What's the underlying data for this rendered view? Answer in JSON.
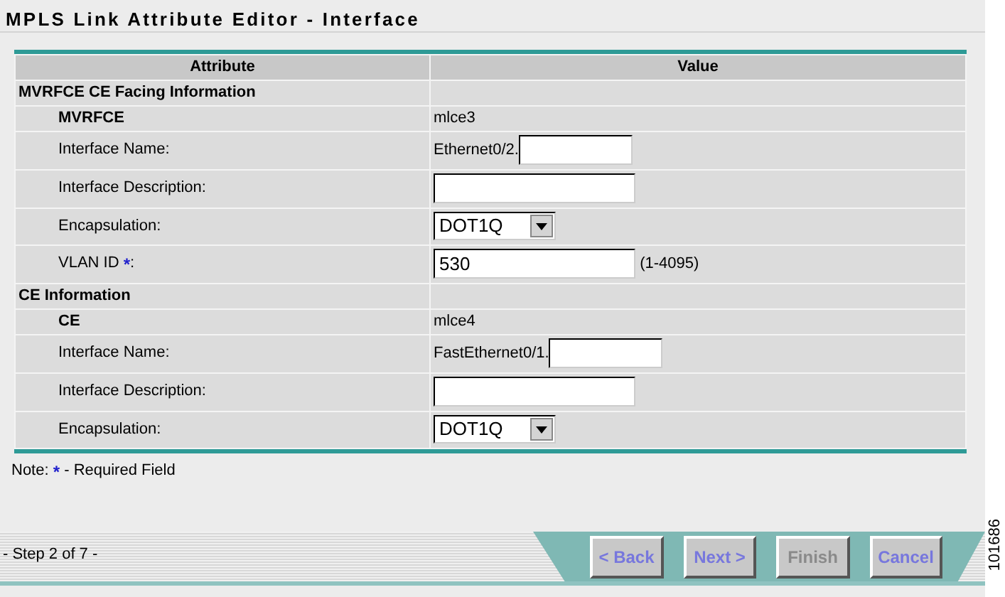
{
  "title": "MPLS Link Attribute Editor - Interface",
  "table": {
    "columns": [
      "Attribute",
      "Value"
    ],
    "sections": [
      {
        "heading": "MVRFCE CE Facing Information",
        "rows": [
          {
            "kind": "text",
            "label": "MVRFCE",
            "bold": true,
            "value": "mlce3"
          },
          {
            "kind": "prefix_input",
            "label": "Interface Name:",
            "prefix": "Ethernet0/2."
          },
          {
            "kind": "input",
            "label": "Interface Description:"
          },
          {
            "kind": "select",
            "label": "Encapsulation:",
            "value": "DOT1Q"
          },
          {
            "kind": "input",
            "label": "VLAN ID",
            "required_mark": "*",
            "suffix": ":",
            "value": "530",
            "hint": "(1-4095)"
          }
        ]
      },
      {
        "heading": "CE Information",
        "rows": [
          {
            "kind": "text",
            "label": "CE",
            "bold": true,
            "value": "mlce4"
          },
          {
            "kind": "prefix_input",
            "label": "Interface Name:",
            "prefix": "FastEthernet0/1."
          },
          {
            "kind": "input",
            "label": "Interface Description:"
          },
          {
            "kind": "select",
            "label": "Encapsulation:",
            "value": "DOT1Q"
          }
        ]
      }
    ]
  },
  "note": {
    "label": "Note:",
    "mark": "*",
    "text": "- Required Field"
  },
  "step": "- Step 2 of 7 -",
  "buttons": [
    {
      "label": "< Back",
      "disabled": false
    },
    {
      "label": "Next >",
      "disabled": false
    },
    {
      "label": "Finish",
      "disabled": true
    },
    {
      "label": "Cancel",
      "disabled": false
    }
  ],
  "figure_number": "101686"
}
